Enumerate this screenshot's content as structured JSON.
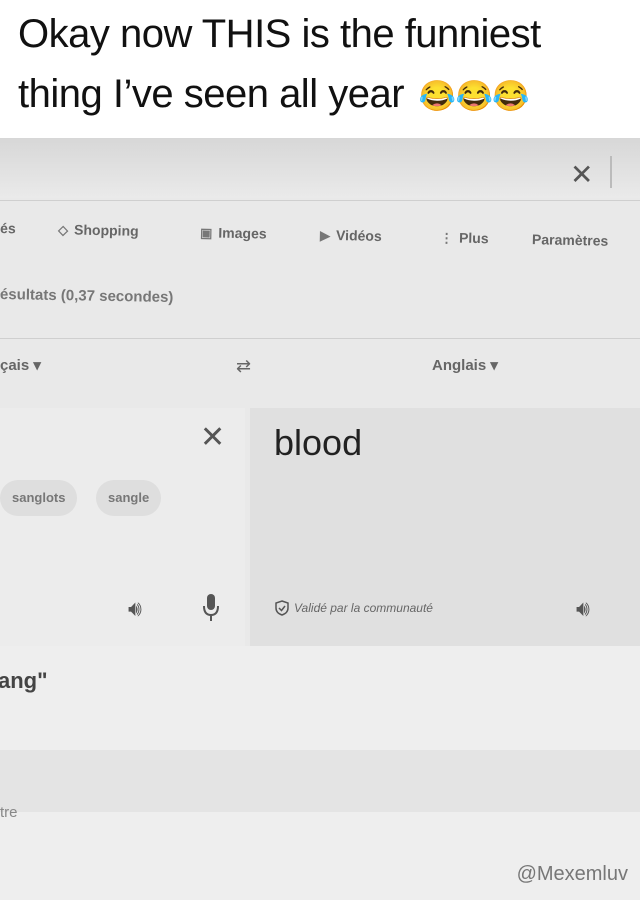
{
  "caption": {
    "line1": "Okay now THIS is the funniest",
    "line2": "thing I’ve seen all year",
    "emoji": "😂😂😂"
  },
  "tabs": [
    {
      "label": "és",
      "icon": ""
    },
    {
      "label": "Shopping",
      "icon": "tag-icon"
    },
    {
      "label": "Images",
      "icon": "image-icon"
    },
    {
      "label": "Vidéos",
      "icon": "video-icon"
    },
    {
      "label": "Plus",
      "icon": "more-vertical-icon"
    },
    {
      "label": "Paramètres",
      "icon": ""
    }
  ],
  "results_text": "ésultats (0,37 secondes)",
  "languages": {
    "source": "çais",
    "target": "Anglais",
    "swap_icon": "swap-icon"
  },
  "translation": {
    "output": "blood",
    "suggestions": [
      "sanglots",
      "sangle"
    ],
    "verified": "Validé par la communauté"
  },
  "below": {
    "definition_word": "ang\"",
    "other_text": "tre"
  },
  "watermark": "@Mexemluv"
}
